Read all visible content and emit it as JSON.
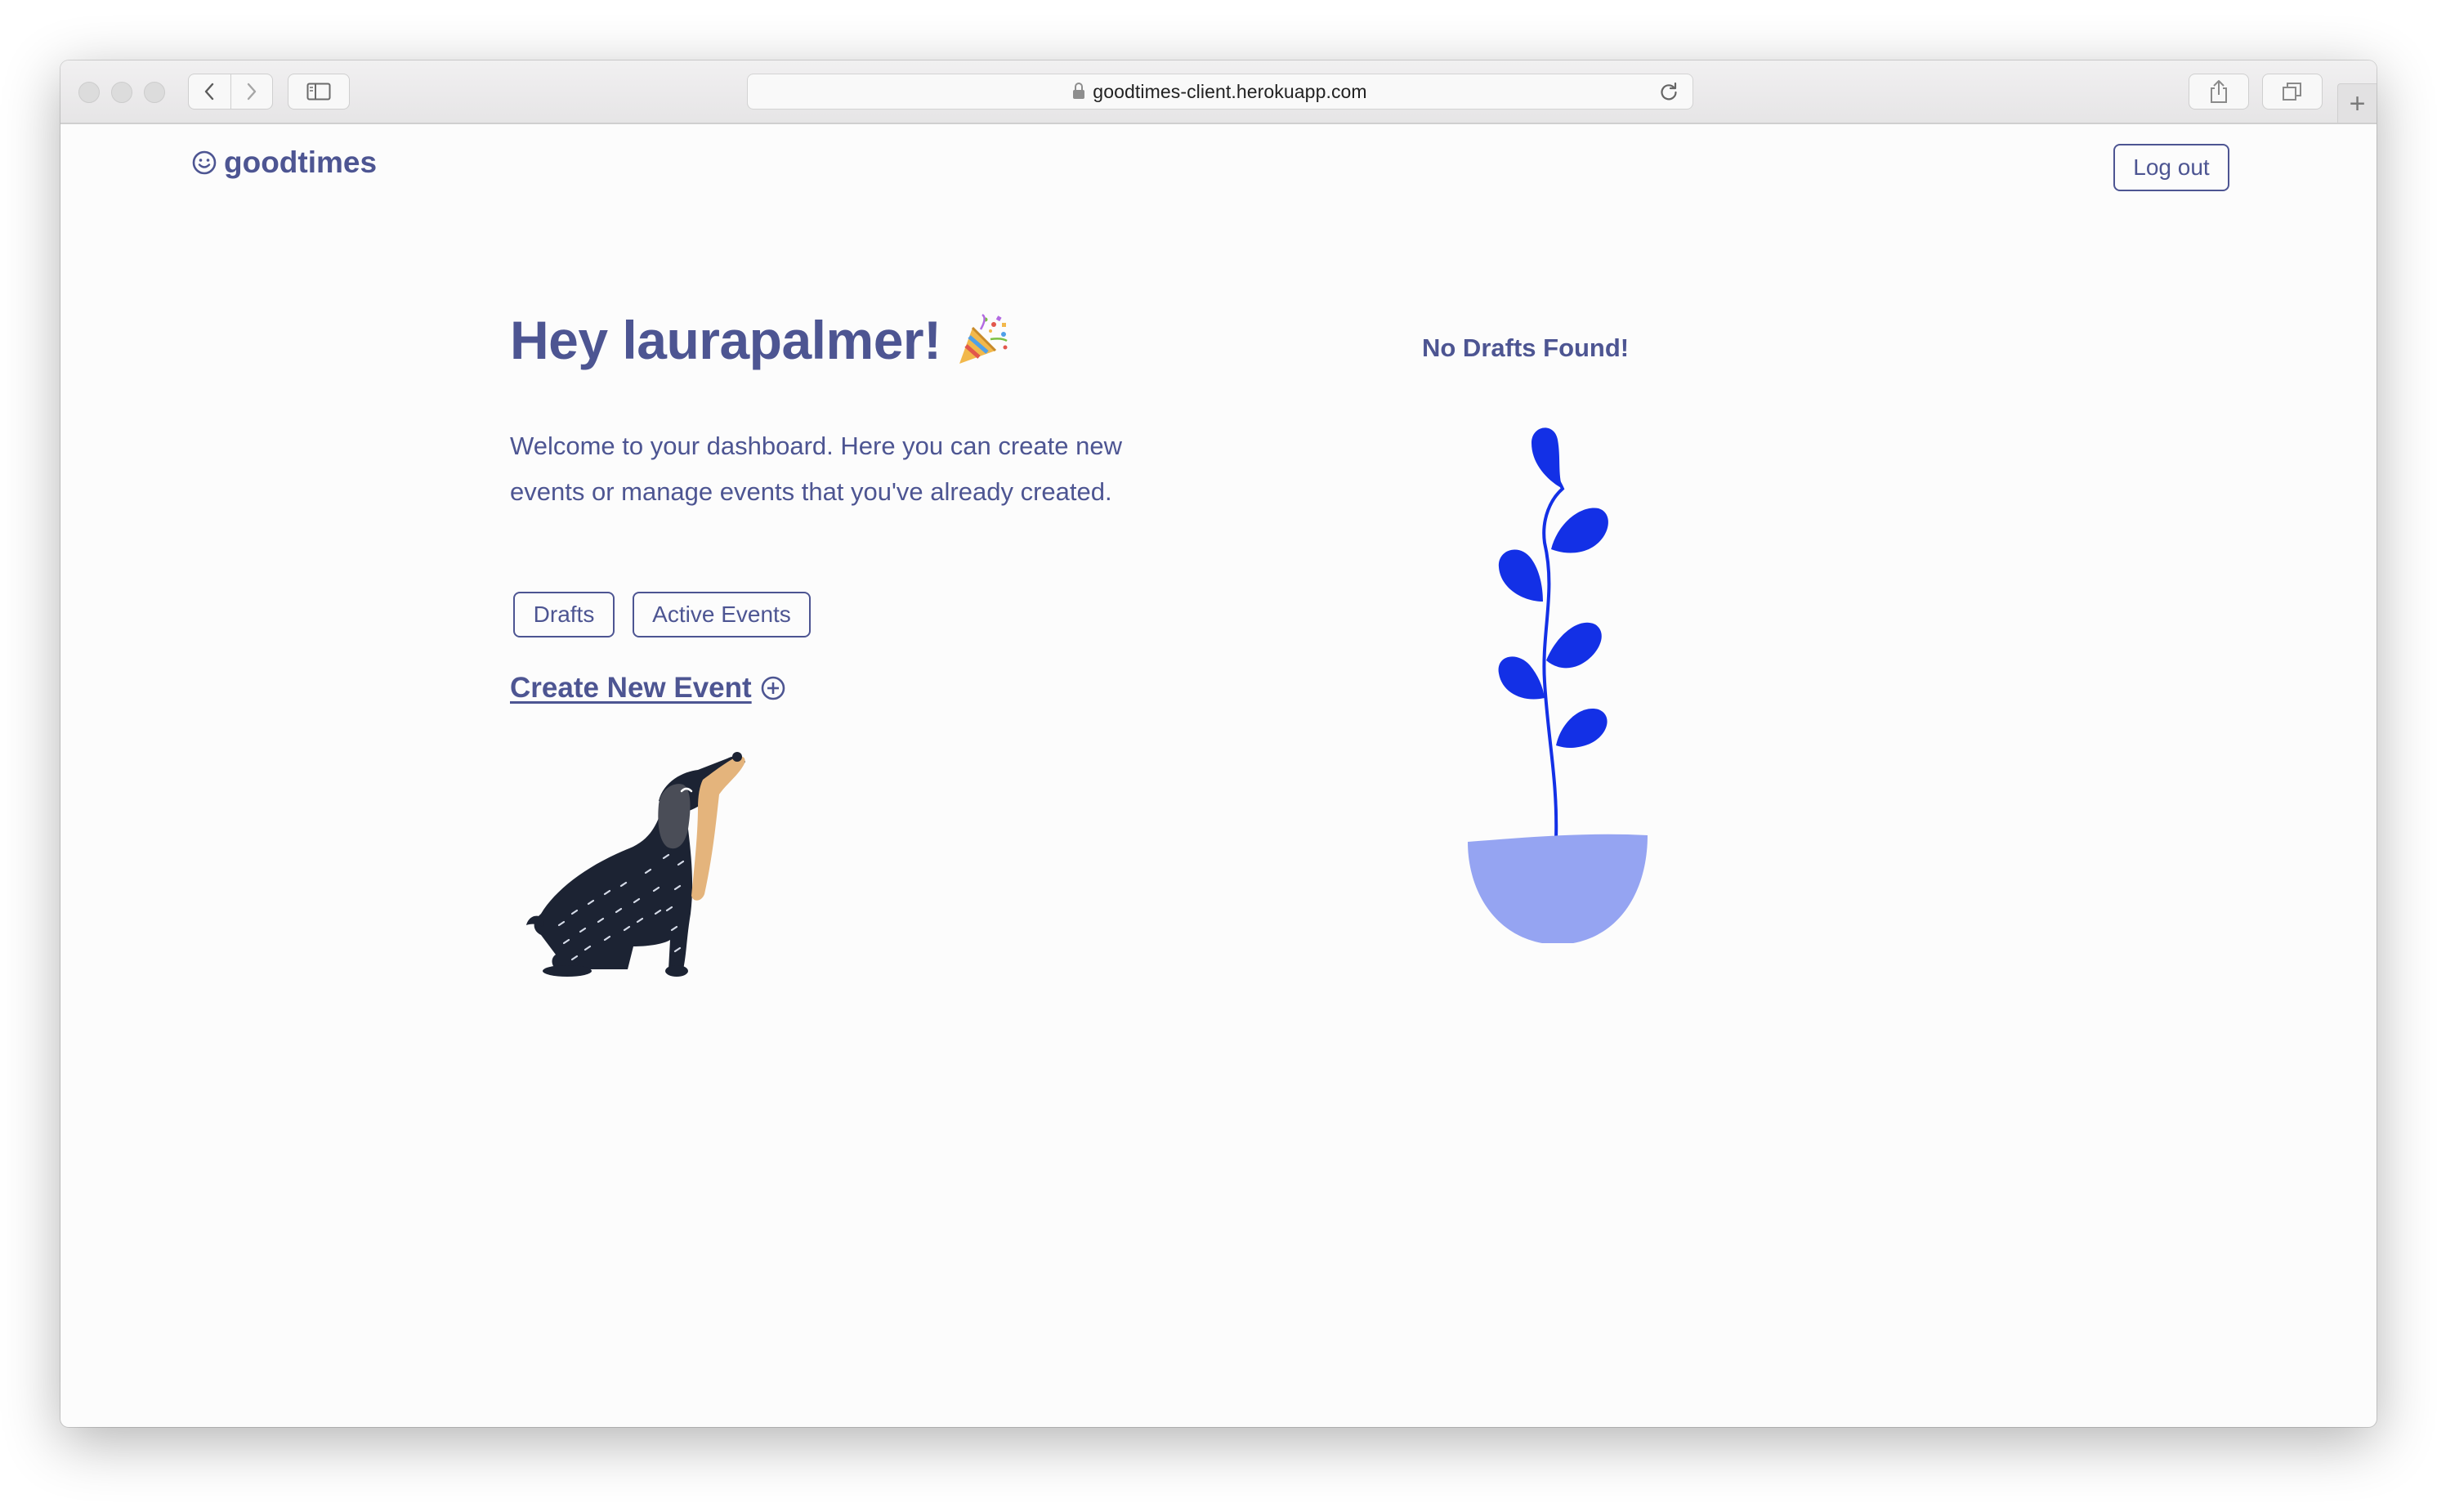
{
  "browser": {
    "url": "goodtimes-client.herokuapp.com",
    "icons": {
      "back": "chevron-left-icon",
      "forward": "chevron-right-icon",
      "sidebar": "sidebar-icon",
      "lock": "lock-icon",
      "reload": "reload-icon",
      "share": "share-icon",
      "tabs": "tabs-icon",
      "new_tab": "plus-icon"
    },
    "new_tab_label": "+"
  },
  "header": {
    "logo_text": "goodtimes",
    "logo_icon": "smiley-icon",
    "logout_label": "Log out"
  },
  "main": {
    "greeting": "Hey laurapalmer!",
    "greeting_icon": "party-popper-icon",
    "welcome_text": "Welcome to your dashboard. Here you can create new events or manage events that you've already created.",
    "buttons": {
      "drafts": "Drafts",
      "active_events": "Active Events"
    },
    "create_event_label": "Create New Event",
    "create_event_icon": "plus-circle-icon",
    "illustration": "howling-dog-illustration"
  },
  "drafts_panel": {
    "empty_message": "No Drafts Found!",
    "illustration": "potted-plant-illustration"
  },
  "colors": {
    "brand": "#4d5592",
    "plant_leaf": "#1330e6",
    "plant_pot": "#95a4f2",
    "dog_body": "#1c2333",
    "dog_ear": "#e4b47c"
  }
}
